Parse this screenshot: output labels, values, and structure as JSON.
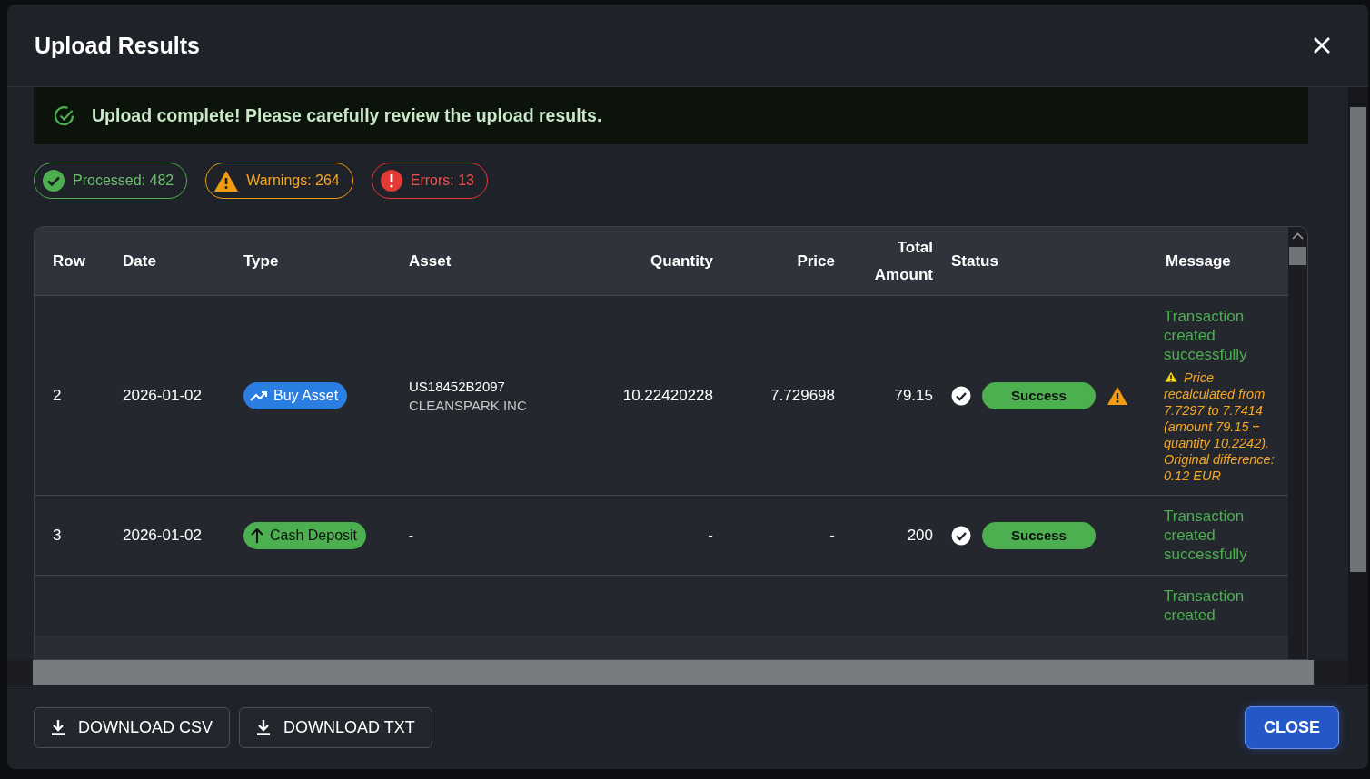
{
  "dialog": {
    "title": "Upload Results"
  },
  "alert": {
    "message": "Upload complete! Please carefully review the upload results."
  },
  "summary": [
    {
      "kind": "processed",
      "label": "Processed: 482"
    },
    {
      "kind": "warnings",
      "label": "Warnings: 264"
    },
    {
      "kind": "errors",
      "label": "Errors: 13"
    }
  ],
  "table": {
    "columns": [
      "Row",
      "Date",
      "Type",
      "Asset",
      "Quantity",
      "Price",
      "Total Amount",
      "Status",
      "Message"
    ],
    "rows": [
      {
        "row": "2",
        "date": "2026-01-02",
        "type": {
          "kind": "buy",
          "label": "Buy Asset"
        },
        "asset": [
          "US18452B2097",
          "CLEANSPARK INC"
        ],
        "quantity": "10.22420228",
        "price": "7.729698",
        "total": "79.15",
        "status": {
          "kind": "success",
          "label": "Success"
        },
        "warning": true,
        "message": "Transaction created successfully",
        "note": "Price recalculated from 7.7297 to 7.7414 (amount 79.15 ÷ quantity 10.2242). Original difference: 0.12 EUR"
      },
      {
        "row": "3",
        "date": "2026-01-02",
        "type": {
          "kind": "deposit",
          "label": "Cash Deposit"
        },
        "asset": [
          "-"
        ],
        "quantity": "-",
        "price": "-",
        "total": "200",
        "status": {
          "kind": "success",
          "label": "Success"
        },
        "warning": false,
        "message": "Transaction created successfully"
      },
      {
        "message": "Transaction created"
      }
    ]
  },
  "footer": {
    "buttons": [
      "DOWNLOAD CSV",
      "DOWNLOAD TXT"
    ],
    "close": "CLOSE"
  }
}
